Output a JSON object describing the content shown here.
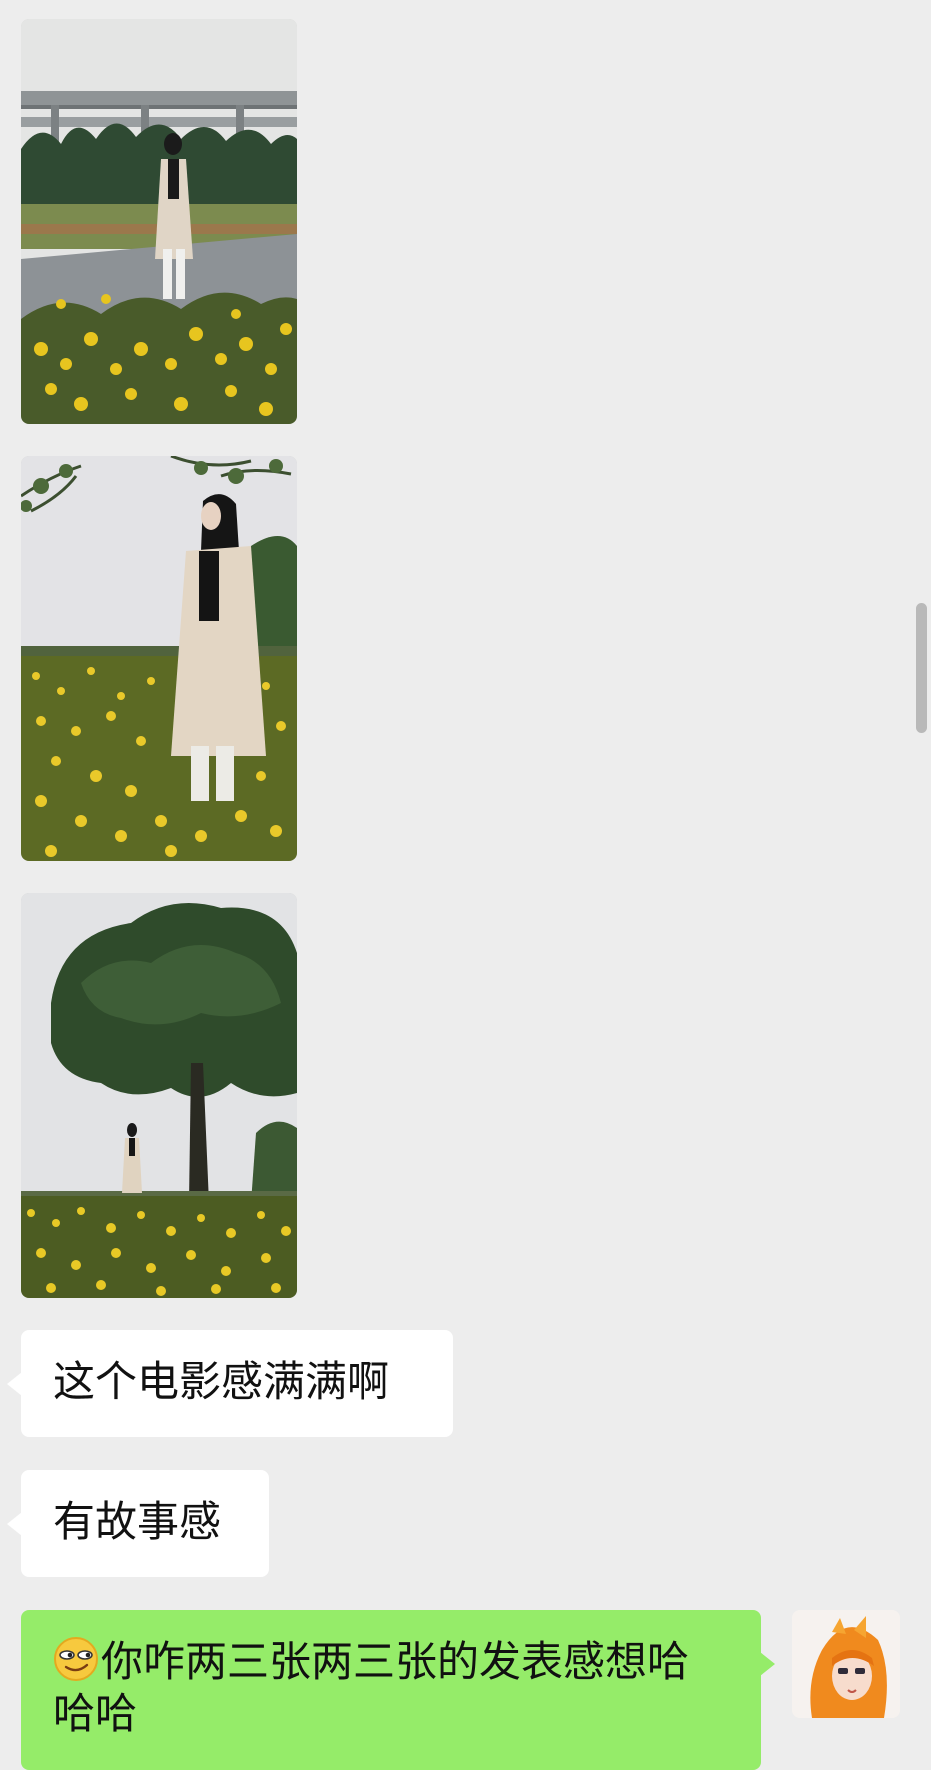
{
  "photos": [
    {
      "scene": "overpass-road-flowers"
    },
    {
      "scene": "flower-field-portrait"
    },
    {
      "scene": "tree-flower-field"
    }
  ],
  "messages": [
    {
      "side": "incoming",
      "text": "这个电影感满满啊"
    },
    {
      "side": "incoming",
      "text": "有故事感"
    },
    {
      "side": "outgoing",
      "emoji": "smirk-emoji",
      "text": "你咋两三张两三张的发表感想哈哈哈"
    }
  ],
  "avatar": {
    "icon": "anime-girl-avatar"
  },
  "colors": {
    "background": "#ededed",
    "incoming_bubble": "#ffffff",
    "outgoing_bubble": "#95ec69",
    "flowers": "#e8c820"
  }
}
